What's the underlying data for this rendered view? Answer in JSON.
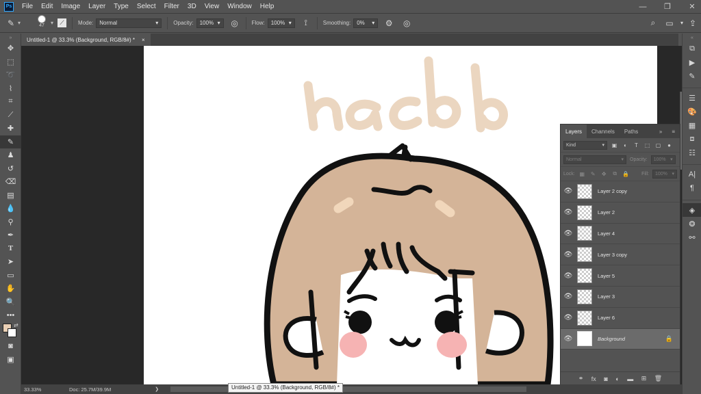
{
  "app": {
    "logo_text": "Ps"
  },
  "menu": [
    "File",
    "Edit",
    "Image",
    "Layer",
    "Type",
    "Select",
    "Filter",
    "3D",
    "View",
    "Window",
    "Help"
  ],
  "options_bar": {
    "brush_size": "47",
    "mode_label": "Mode:",
    "mode_value": "Normal",
    "opacity_label": "Opacity:",
    "opacity_value": "100%",
    "flow_label": "Flow:",
    "flow_value": "100%",
    "smoothing_label": "Smoothing:",
    "smoothing_value": "0%"
  },
  "document_tab": {
    "title": "Untitled-1 @ 33.3% (Background, RGB/8#) *",
    "close": "×"
  },
  "status": {
    "zoom": "33.33%",
    "doc": "Doc: 25.7M/39.9M",
    "tooltip": "Untitled-1 @ 33.3% (Background, RGB/8#) *"
  },
  "canvas_text": "hac lob",
  "colors": {
    "foreground": "#e9cfb4",
    "background": "#ffffff",
    "hair": "#d4b498",
    "blush": "#f6b3b3"
  },
  "layers_panel": {
    "tabs": [
      "Layers",
      "Channels",
      "Paths"
    ],
    "filter_kind": "Kind",
    "blend_mode": "Normal",
    "opacity_label": "Opacity:",
    "opacity_value": "100%",
    "lock_label": "Lock:",
    "fill_label": "Fill:",
    "fill_value": "100%",
    "layers": [
      {
        "name": "Layer 2 copy",
        "visible": true,
        "selected": false
      },
      {
        "name": "Layer 2",
        "visible": true,
        "selected": false
      },
      {
        "name": "Layer 4",
        "visible": true,
        "selected": false
      },
      {
        "name": "Layer 3 copy",
        "visible": true,
        "selected": false
      },
      {
        "name": "Layer 5",
        "visible": true,
        "selected": false
      },
      {
        "name": "Layer 3",
        "visible": true,
        "selected": false
      },
      {
        "name": "Layer 6",
        "visible": true,
        "selected": false
      },
      {
        "name": "Background",
        "visible": true,
        "selected": true,
        "locked": true
      }
    ]
  }
}
